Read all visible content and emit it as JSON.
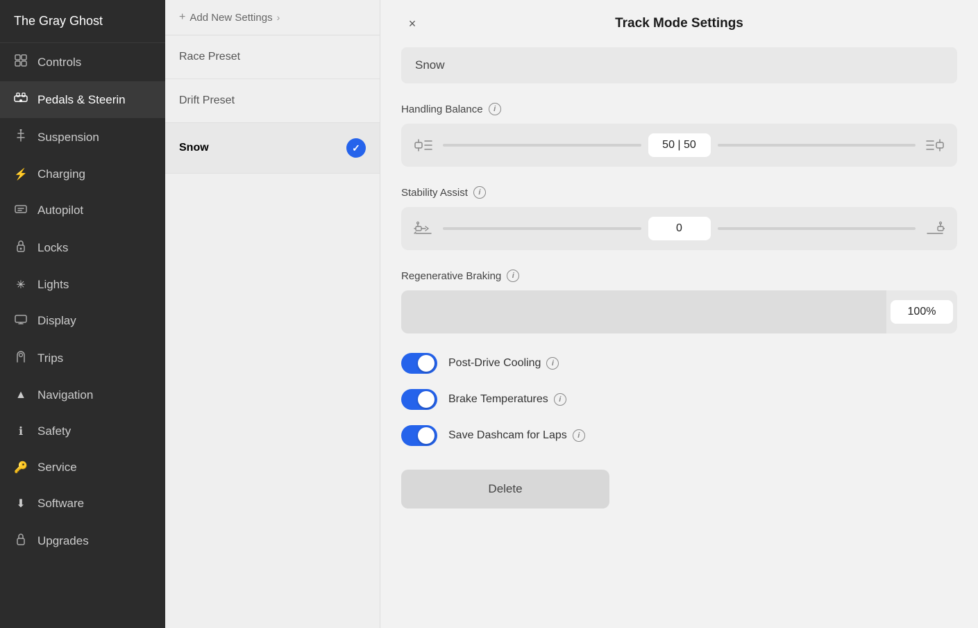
{
  "app": {
    "car_name": "The Gray Ghost"
  },
  "sidebar": {
    "items": [
      {
        "id": "controls",
        "label": "Controls",
        "icon": "⊞",
        "active": false
      },
      {
        "id": "pedals",
        "label": "Pedals & Steerin",
        "icon": "🚗",
        "active": true
      },
      {
        "id": "suspension",
        "label": "Suspension",
        "icon": "🔧",
        "active": false
      },
      {
        "id": "charging",
        "label": "Charging",
        "icon": "⚡",
        "active": false
      },
      {
        "id": "autopilot",
        "label": "Autopilot",
        "icon": "⊟",
        "active": false
      },
      {
        "id": "locks",
        "label": "Locks",
        "icon": "🔒",
        "active": false
      },
      {
        "id": "lights",
        "label": "Lights",
        "icon": "✳",
        "active": false
      },
      {
        "id": "display",
        "label": "Display",
        "icon": "⬜",
        "active": false
      },
      {
        "id": "trips",
        "label": "Trips",
        "icon": "⌚",
        "active": false
      },
      {
        "id": "navigation",
        "label": "Navigation",
        "icon": "▲",
        "active": false
      },
      {
        "id": "safety",
        "label": "Safety",
        "icon": "ℹ",
        "active": false
      },
      {
        "id": "service",
        "label": "Service",
        "icon": "🔑",
        "active": false
      },
      {
        "id": "software",
        "label": "Software",
        "icon": "⬇",
        "active": false
      },
      {
        "id": "upgrades",
        "label": "Upgrades",
        "icon": "🔒",
        "active": false
      }
    ]
  },
  "middle_panel": {
    "add_label": "Add New Settings",
    "items": [
      {
        "id": "race",
        "label": "Race Preset",
        "active": false
      },
      {
        "id": "drift",
        "label": "Drift Preset",
        "active": false
      },
      {
        "id": "snow",
        "label": "Snow",
        "active": true
      }
    ]
  },
  "main": {
    "title": "Track Mode Settings",
    "close_label": "×",
    "preset_name": "Snow",
    "sections": {
      "handling_balance": {
        "label": "Handling Balance",
        "value": "50 | 50",
        "info": "i"
      },
      "stability_assist": {
        "label": "Stability Assist",
        "value": "0",
        "info": "i"
      },
      "regenerative_braking": {
        "label": "Regenerative Braking",
        "value": "100%",
        "info": "i"
      }
    },
    "toggles": [
      {
        "id": "post_drive_cooling",
        "label": "Post-Drive Cooling",
        "on": true
      },
      {
        "id": "brake_temperatures",
        "label": "Brake Temperatures",
        "on": true
      },
      {
        "id": "save_dashcam",
        "label": "Save Dashcam for Laps",
        "on": true
      }
    ],
    "delete_label": "Delete"
  }
}
